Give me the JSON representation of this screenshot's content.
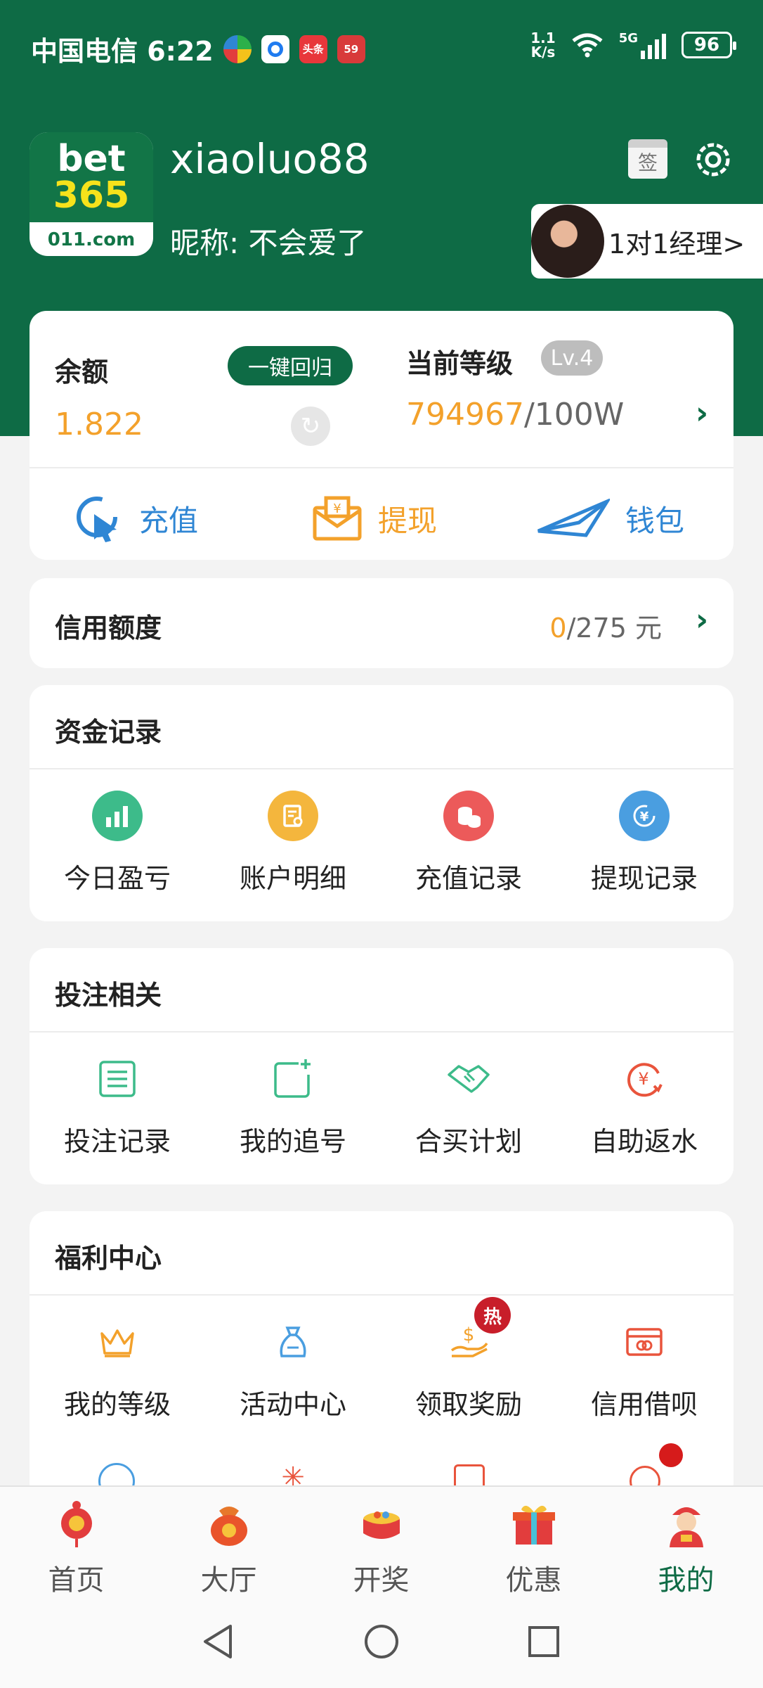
{
  "status_bar": {
    "carrier_time": "中国电信 6:22",
    "speed_value": "1.1",
    "speed_unit": "K/s",
    "network": "5G",
    "battery": "96",
    "apps": [
      {
        "icon": "colorful-app-icon",
        "label": ""
      },
      {
        "icon": "blue-app-icon",
        "label": ""
      },
      {
        "icon": "toutiao-app-icon",
        "label": "头条"
      },
      {
        "icon": "red-app-icon",
        "label": "59"
      }
    ]
  },
  "profile": {
    "logo": {
      "line1": "bet",
      "line2": "365",
      "domain": "011.com"
    },
    "username": "xiaoluo88",
    "nickname": "昵称: 不会爱了",
    "sign_label": "签",
    "manager_button": "1对1经理>"
  },
  "balance_card": {
    "balance_label": "余额",
    "recall_button": "一键回归",
    "balance_value": "1.822",
    "level_label": "当前等级",
    "level_badge": "Lv.4",
    "level_current": "794967",
    "level_target": "/100W",
    "actions": [
      {
        "label": "充值",
        "icon": "recharge-icon"
      },
      {
        "label": "提现",
        "icon": "withdraw-icon"
      },
      {
        "label": "钱包",
        "icon": "wallet-icon"
      }
    ]
  },
  "credit": {
    "label": "信用额度",
    "used": "0",
    "total": "/275 元"
  },
  "fund_records": {
    "title": "资金记录",
    "items": [
      {
        "label": "今日盈亏",
        "icon": "bar-chart-icon",
        "color": "#3dbb8a"
      },
      {
        "label": "账户明细",
        "icon": "account-detail-icon",
        "color": "#f4b63d"
      },
      {
        "label": "充值记录",
        "icon": "coins-icon",
        "color": "#ec5a5a"
      },
      {
        "label": "提现记录",
        "icon": "yen-exchange-icon",
        "color": "#4a9ee0"
      }
    ]
  },
  "bet_related": {
    "title": "投注相关",
    "items": [
      {
        "label": "投注记录",
        "icon": "list-icon"
      },
      {
        "label": "我的追号",
        "icon": "add-square-icon"
      },
      {
        "label": "合买计划",
        "icon": "handshake-icon"
      },
      {
        "label": "自助返水",
        "icon": "yen-refresh-icon"
      }
    ]
  },
  "welfare": {
    "title": "福利中心",
    "items": [
      {
        "label": "我的等级",
        "icon": "crown-icon"
      },
      {
        "label": "活动中心",
        "icon": "gift-bag-icon"
      },
      {
        "label": "领取奖励",
        "icon": "dollar-hand-icon",
        "badge": "热"
      },
      {
        "label": "信用借呗",
        "icon": "credit-card-icon"
      }
    ]
  },
  "bottom_nav": [
    {
      "label": "首页",
      "icon": "home-icon"
    },
    {
      "label": "大厅",
      "icon": "hall-icon"
    },
    {
      "label": "开奖",
      "icon": "lottery-drum-icon"
    },
    {
      "label": "优惠",
      "icon": "gift-box-icon"
    },
    {
      "label": "我的",
      "icon": "mine-icon",
      "active": true
    }
  ],
  "colors": {
    "brand_green": "#0e6b45",
    "accent_orange": "#f3a12b",
    "accent_blue": "#2f86d4"
  }
}
